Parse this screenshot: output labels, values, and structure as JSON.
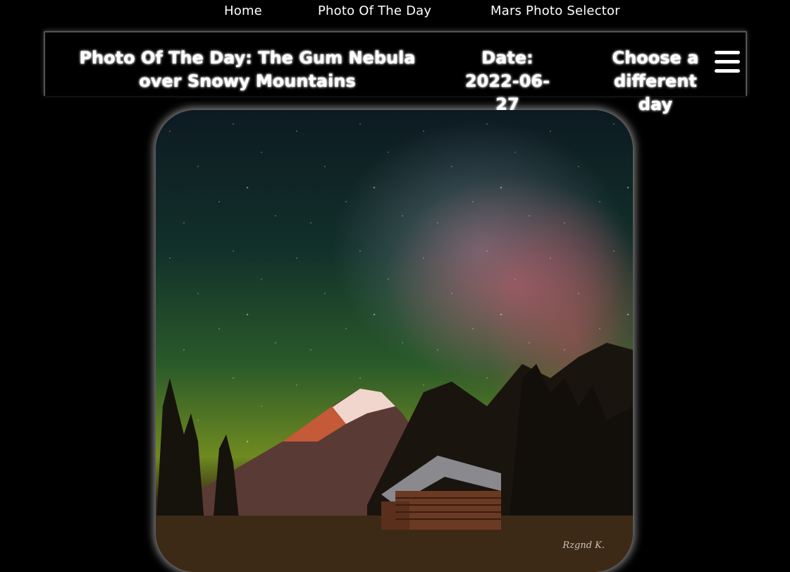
{
  "nav": {
    "home": "Home",
    "photo_of_the_day": "Photo Of The Day",
    "mars_photo_selector": "Mars Photo Selector"
  },
  "header": {
    "title": "Photo Of The Day: The Gum Nebula over Snowy Mountains",
    "date": "Date: 2022-06-27",
    "choose_day": "Choose a different day",
    "menu_icon": "hamburger-menu-icon"
  },
  "photo": {
    "description": "Night sky with Milky Way and red Gum Nebula above snowy mountain peak and a wooden log cabin in foreground"
  }
}
